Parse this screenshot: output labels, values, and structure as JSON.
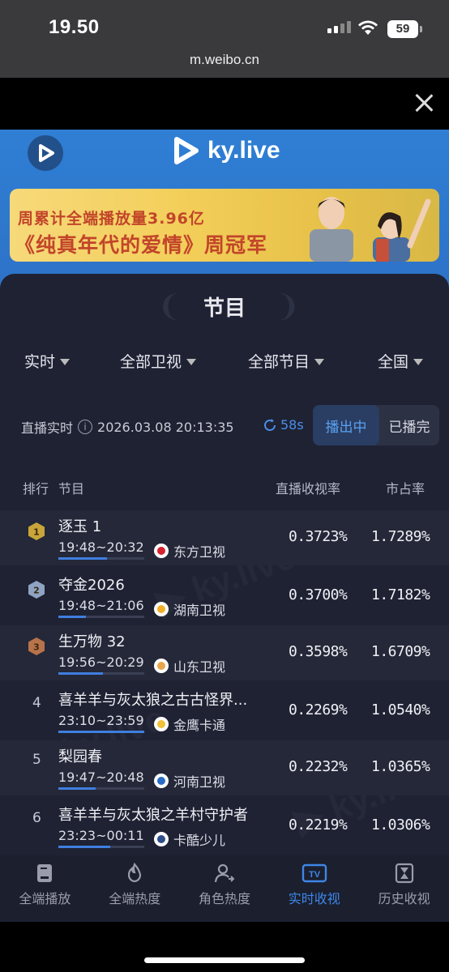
{
  "status": {
    "time": "19.50",
    "battery": "59"
  },
  "browser": {
    "url": "m.weibo.cn"
  },
  "brand": {
    "name": "ky.live"
  },
  "banner": {
    "line1": "周累计全端播放量3.96亿",
    "line2": "《纯真年代的爱情》周冠军"
  },
  "page": {
    "title": "节目"
  },
  "filters": [
    {
      "label": "实时"
    },
    {
      "label": "全部卫视"
    },
    {
      "label": "全部节目"
    },
    {
      "label": "全国"
    }
  ],
  "live": {
    "label": "直播实时",
    "datetime": "2026.03.08 20:13:35",
    "countdown": "58s",
    "seg_on": "播出中",
    "seg_off": "已播完"
  },
  "table": {
    "headers": {
      "rank": "排行",
      "program": "节目",
      "rating": "直播收视率",
      "share": "市占率"
    },
    "rows": [
      {
        "rank": "1",
        "name": "逐玉 1",
        "time": "19:48~20:32",
        "channel": "东方卫视",
        "rating": "0.3723%",
        "share": "1.7289%",
        "progress": 0.57
      },
      {
        "rank": "2",
        "name": "夺金2026",
        "time": "19:48~21:06",
        "channel": "湖南卫视",
        "rating": "0.3700%",
        "share": "1.7182%",
        "progress": 0.32
      },
      {
        "rank": "3",
        "name": "生万物 32",
        "time": "19:56~20:29",
        "channel": "山东卫视",
        "rating": "0.3598%",
        "share": "1.6709%",
        "progress": 0.52
      },
      {
        "rank": "4",
        "name": "喜羊羊与灰太狼之古古怪界...",
        "time": "23:10~23:59",
        "channel": "金鹰卡通",
        "rating": "0.2269%",
        "share": "1.0540%",
        "progress": 1.0
      },
      {
        "rank": "5",
        "name": "梨园春",
        "time": "19:47~20:48",
        "channel": "河南卫视",
        "rating": "0.2232%",
        "share": "1.0365%",
        "progress": 0.43
      },
      {
        "rank": "6",
        "name": "喜羊羊与灰太狼之羊村守护者",
        "time": "23:23~00:11",
        "channel": "卡酷少儿",
        "rating": "0.2219%",
        "share": "1.0306%",
        "progress": 0.6
      }
    ]
  },
  "nav": [
    {
      "label": "全端播放",
      "icon": "playback-icon",
      "active": false
    },
    {
      "label": "全端热度",
      "icon": "flame-icon",
      "active": false
    },
    {
      "label": "角色热度",
      "icon": "person-icon",
      "active": false
    },
    {
      "label": "实时收视",
      "icon": "tv-icon",
      "active": true
    },
    {
      "label": "历史收视",
      "icon": "hourglass-icon",
      "active": false
    }
  ],
  "colors": {
    "accent": "#3e86e8",
    "gold": "#c9a53a",
    "silver": "#8ea4c2",
    "bronze": "#b8734a"
  }
}
